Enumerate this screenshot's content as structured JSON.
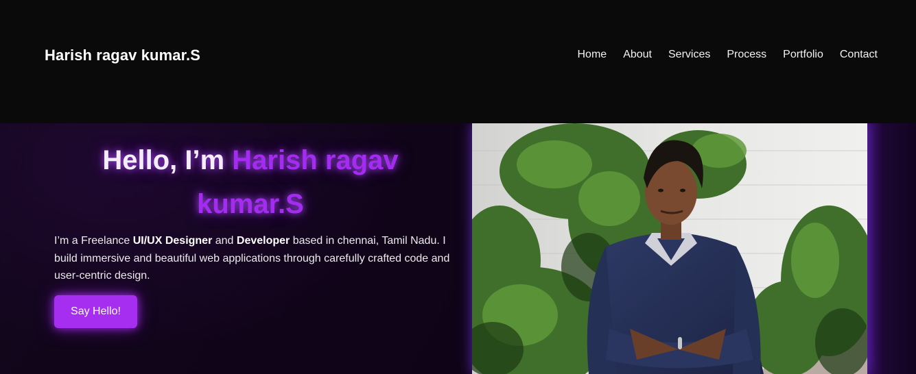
{
  "header": {
    "brand": "Harish ragav kumar.S",
    "nav": [
      "Home",
      "About",
      "Services",
      "Process",
      "Portfolio",
      "Contact"
    ]
  },
  "hero": {
    "greeting": "Hello, I’m ",
    "name": "Harish ragav kumar.S",
    "intro": {
      "p1": "I’m a Freelance ",
      "b1": "UI/UX Designer",
      "p2": " and ",
      "b2": "Developer",
      "p3": " based in chennai, Tamil Nadu. I build immersive and beautiful web applications through carefully crafted code and user-centric design."
    },
    "cta_label": "Say Hello!"
  },
  "colors": {
    "accent": "#a62ef0",
    "background": "#0a0a0a",
    "hero_background": "#12061c"
  }
}
